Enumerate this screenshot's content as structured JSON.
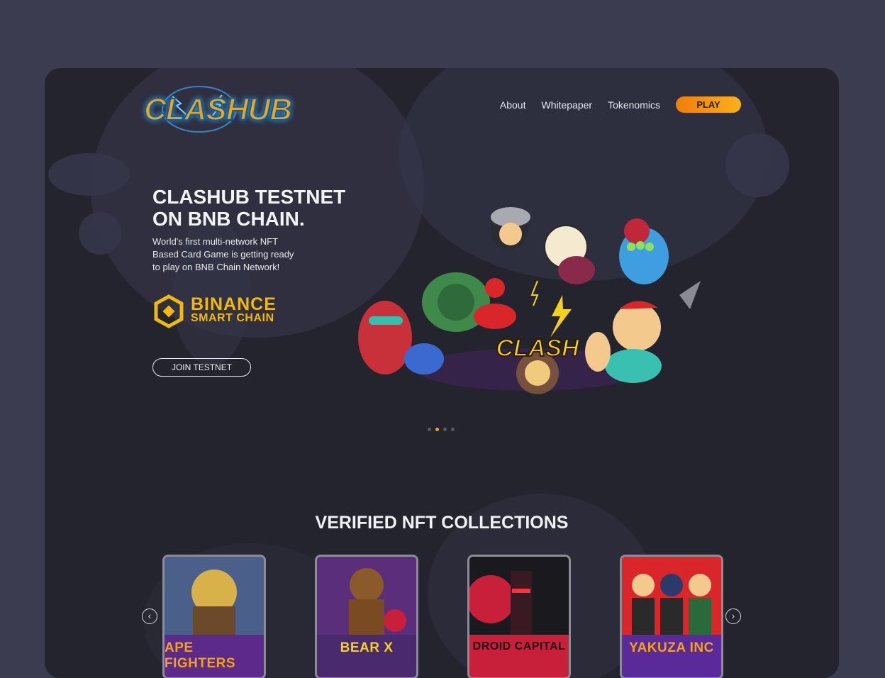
{
  "brand": {
    "logo_text": "CLASHUB"
  },
  "nav": {
    "about": "About",
    "whitepaper": "Whitepaper",
    "tokenomics": "Tokenomics",
    "play": "PLAY"
  },
  "hero": {
    "title_line1": "CLASHUB TESTNET",
    "title_line2": "ON BNB CHAIN.",
    "subtitle": "World's first multi-network NFT Based Card Game is getting ready to play on BNB Chain Network!",
    "binance_line1": "BINANCE",
    "binance_line2": "SMART CHAIN",
    "join_button": "JOIN TESTNET",
    "art_text": "CLASH"
  },
  "carousel": {
    "dot_count": 4,
    "active_index": 1
  },
  "collections": {
    "title": "VERIFIED NFT COLLECTIONS",
    "prev_icon": "chevron-left-icon",
    "next_icon": "chevron-right-icon",
    "items": [
      {
        "label": "APE FIGHTERS",
        "band_color": "#5b2a8a",
        "label_color": "#f2a218"
      },
      {
        "label": "BEAR X",
        "band_color": "#4a2a6e",
        "label_color": "#f5d21a"
      },
      {
        "label": "DROID CAPITAL",
        "band_color": "#c8203a",
        "label_color": "#1d0d14"
      },
      {
        "label": "YAKUZA INC",
        "band_color": "#5a2a9a",
        "label_color": "#f2a218"
      }
    ]
  },
  "colors": {
    "accent": "#f2a218",
    "background": "#3b3c50",
    "panel": "#24242f",
    "binance": "#f0b90b"
  }
}
